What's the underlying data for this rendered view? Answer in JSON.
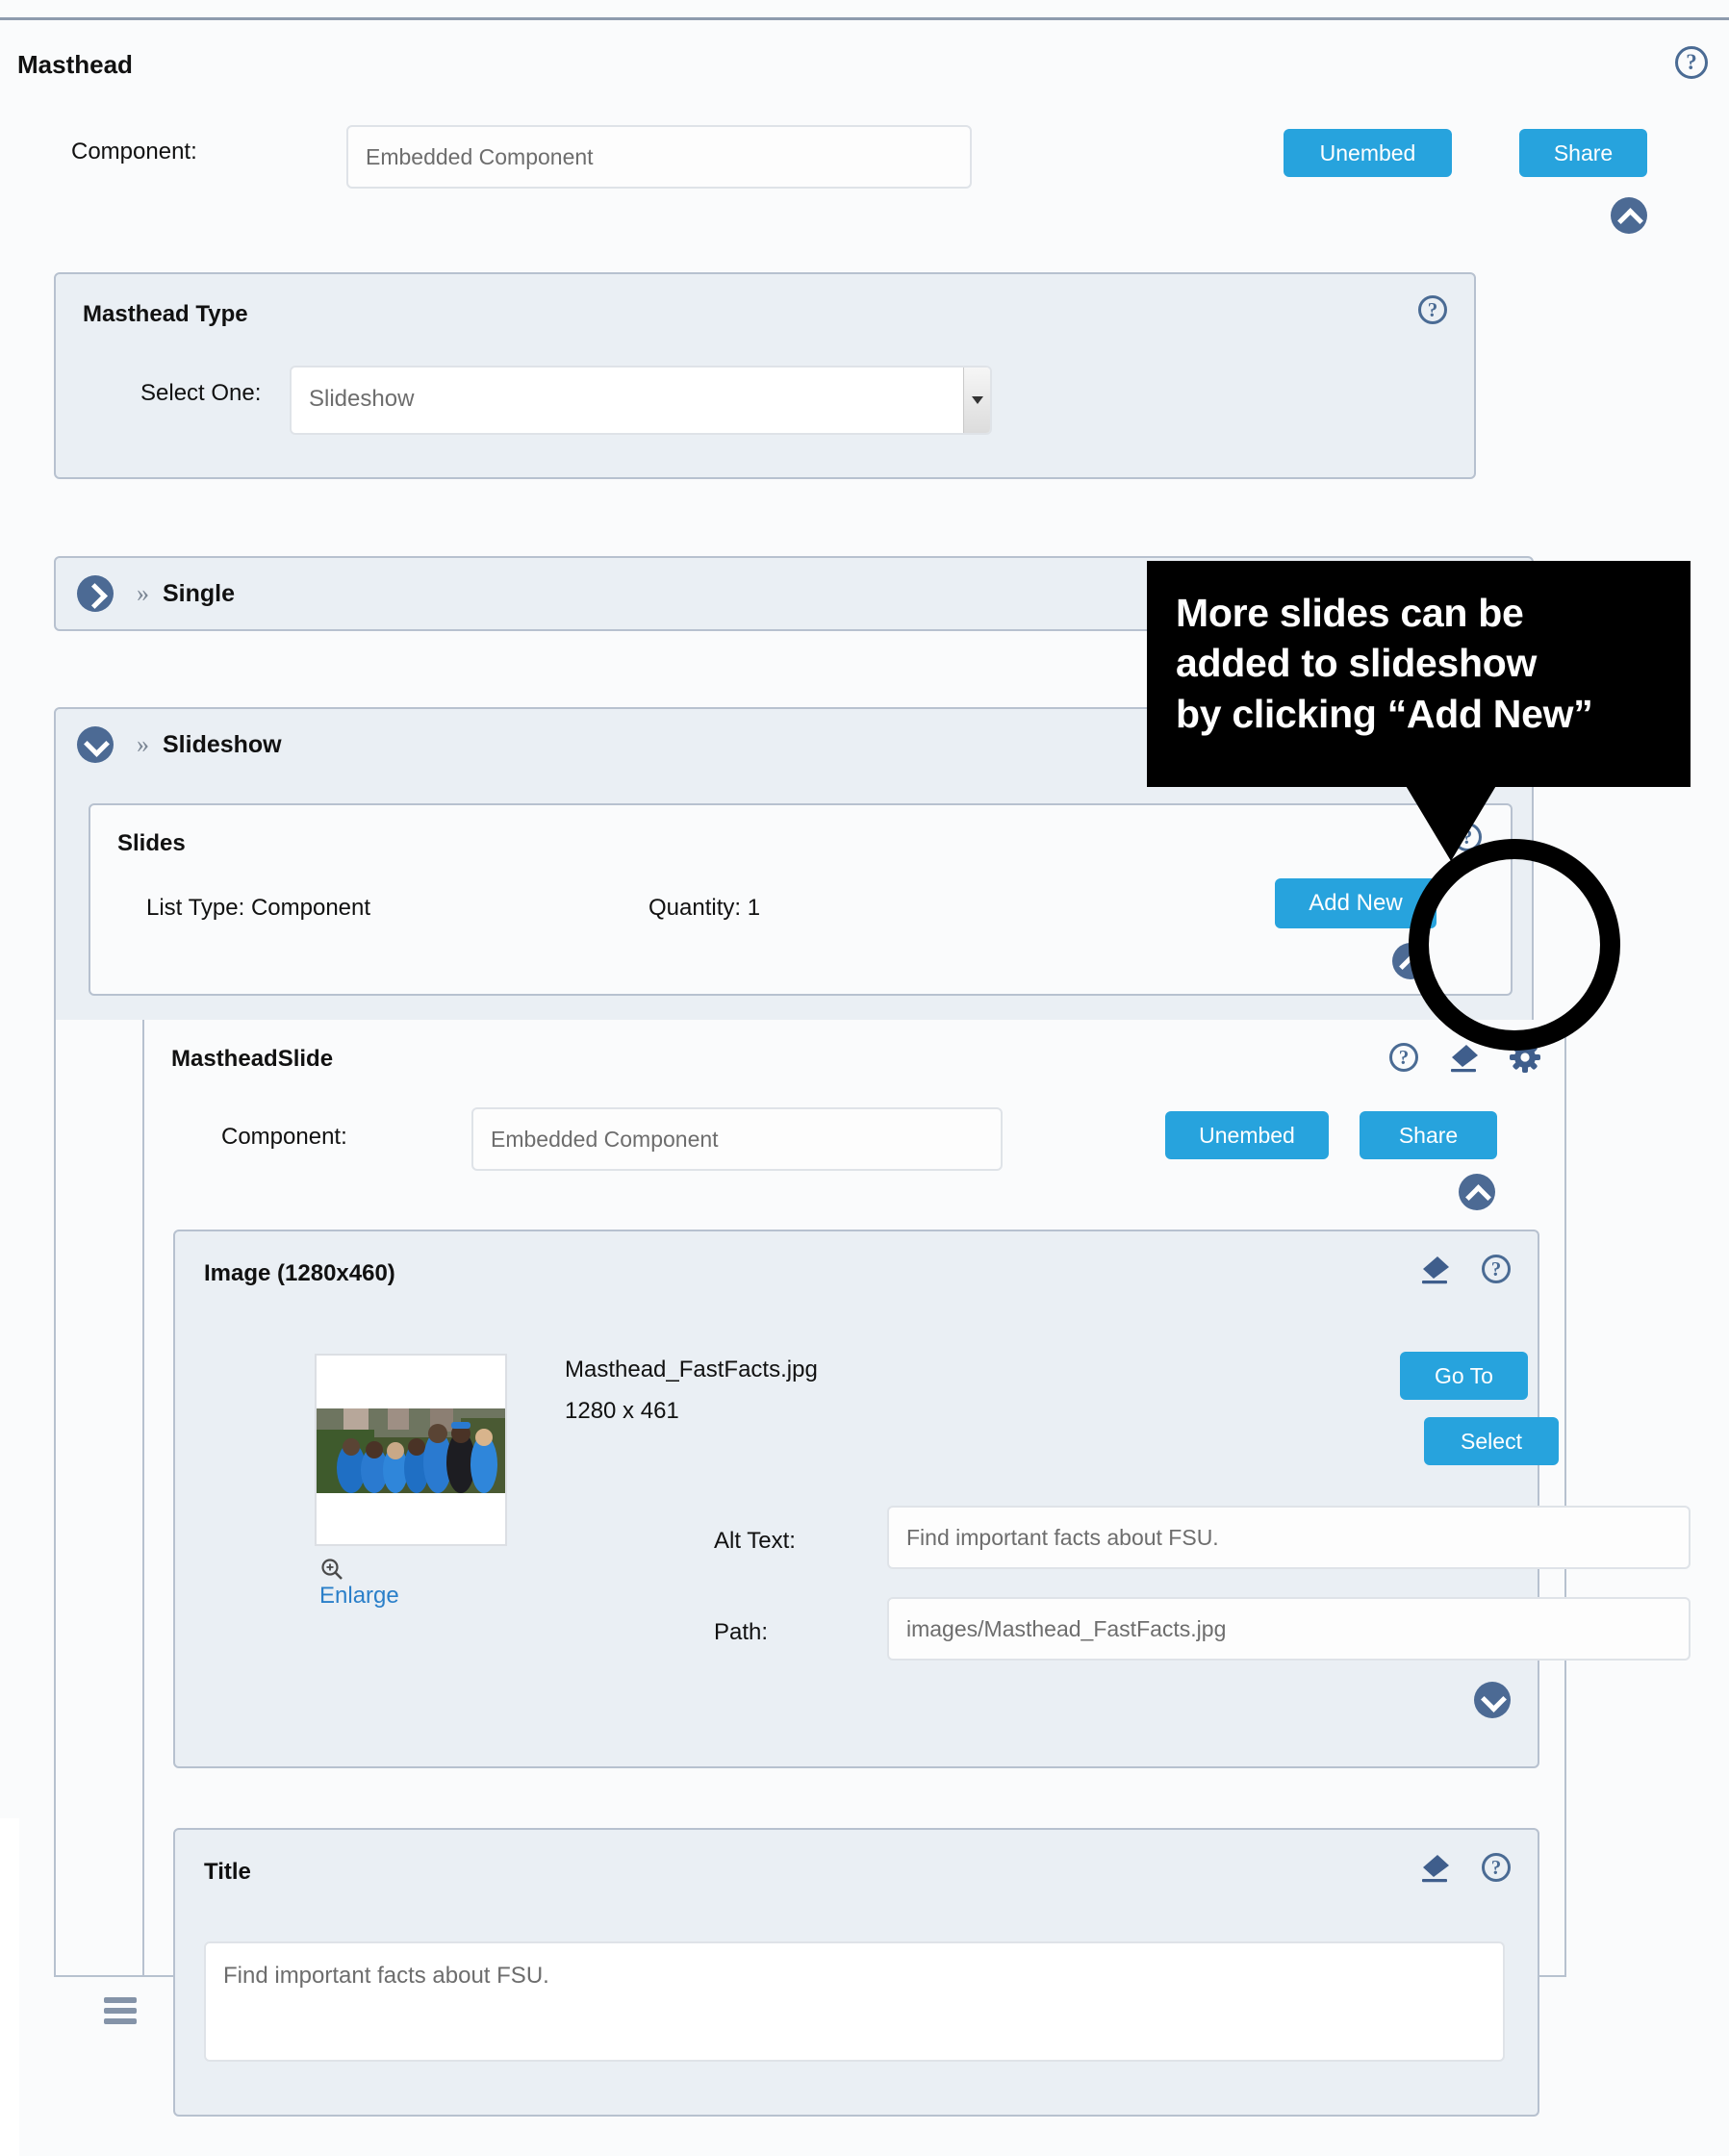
{
  "masthead": {
    "title": "Masthead",
    "component_label": "Component:",
    "component_value": "Embedded Component",
    "unembed_label": "Unembed",
    "share_label": "Share",
    "help_glyph": "?"
  },
  "masthead_type": {
    "title": "Masthead Type",
    "select_label": "Select One:",
    "selected_value": "Slideshow",
    "options": [
      "Slideshow"
    ],
    "help_glyph": "?"
  },
  "sections": {
    "single_label": "Single",
    "slideshow_label": "Slideshow",
    "chevron_prefix": "»"
  },
  "slides": {
    "title": "Slides",
    "list_type": "List Type: Component",
    "quantity": "Quantity: 1",
    "add_new_label": "Add New",
    "help_glyph": "?"
  },
  "masthead_slide": {
    "title": "MastheadSlide",
    "component_label": "Component:",
    "component_value": "Embedded Component",
    "unembed_label": "Unembed",
    "share_label": "Share",
    "help_glyph": "?"
  },
  "image": {
    "title": "Image (1280x460)",
    "file_name": "Masthead_FastFacts.jpg",
    "dimensions": "1280 x 461",
    "enlarge_label": "Enlarge",
    "goto_label": "Go To",
    "select_label": "Select",
    "alt_text_label": "Alt Text:",
    "alt_text_value": "Find important facts about FSU.",
    "path_label": "Path:",
    "path_value": "images/Masthead_FastFacts.jpg",
    "help_glyph": "?"
  },
  "title_section": {
    "title": "Title",
    "value": "Find important facts about FSU.",
    "help_glyph": "?"
  },
  "annotation": {
    "text": "More slides can be\nadded to slideshow\nby clicking “Add New”"
  },
  "colors": {
    "accent_blue": "#27a3dd",
    "icon_blue": "#4a6b94",
    "panel_bg": "#eaeff4",
    "page_bg": "#fafbfc",
    "border": "#b7c1cf",
    "link_blue": "#2a7fc9"
  }
}
